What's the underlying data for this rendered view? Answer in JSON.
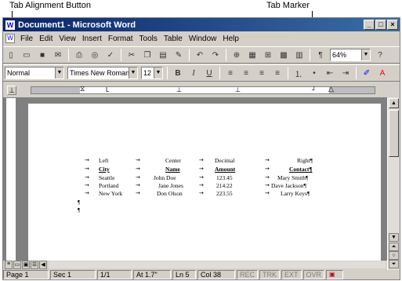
{
  "callouts": {
    "left": "Tab Alignment Button",
    "right": "Tab Marker"
  },
  "window": {
    "title": "Document1 - Microsoft Word"
  },
  "menu": [
    "File",
    "Edit",
    "View",
    "Insert",
    "Format",
    "Tools",
    "Table",
    "Window",
    "Help"
  ],
  "toolbar2": {
    "style": "Normal",
    "font": "Times New Roman",
    "size": "12",
    "zoom": "64%"
  },
  "table": {
    "headers": [
      "Left",
      "Center",
      "Decimal",
      "Right¶"
    ],
    "subheaders": [
      "City",
      "Name",
      "Amount",
      "Contact¶"
    ],
    "rows": [
      [
        "Seattle",
        "John Doe",
        "123.45",
        "Mary Smith¶"
      ],
      [
        "Portland",
        "Jane Jones",
        "214.22",
        "Dave Jackson¶"
      ],
      [
        "New York",
        "Don Olson",
        "223.55",
        "Larry Keys¶"
      ]
    ],
    "para1": "¶",
    "para2": "¶"
  },
  "status": {
    "page": "Page 1",
    "sec": "Sec 1",
    "pages": "1/1",
    "at": "At 1.7\"",
    "ln": "Ln 5",
    "col": "Col 38",
    "rec": "REC",
    "trk": "TRK",
    "ext": "EXT",
    "ovr": "OVR"
  }
}
